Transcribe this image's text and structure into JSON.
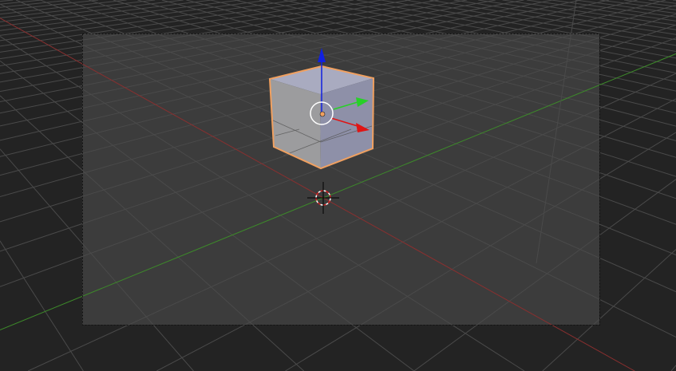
{
  "viewport": {
    "background_color": "#232323",
    "camera_frame_color": "#3a3a3a",
    "grid_color": "#4a4a4a",
    "x_axis_color": "#8a2f2f",
    "y_axis_color": "#3d8a2a"
  },
  "object": {
    "name_icon": "cube-mesh",
    "selected": true,
    "outline_color": "#f0a060",
    "top_face_color": "#a9abc0",
    "left_face_color": "#9c9c9e",
    "right_face_color": "#8e90a8"
  },
  "gizmo": {
    "x_color": "#e01515",
    "y_color": "#28d028",
    "z_color": "#1020e0",
    "center_icon": "origin-dot-icon"
  },
  "cursor": {
    "icon": "3d-cursor-icon"
  }
}
